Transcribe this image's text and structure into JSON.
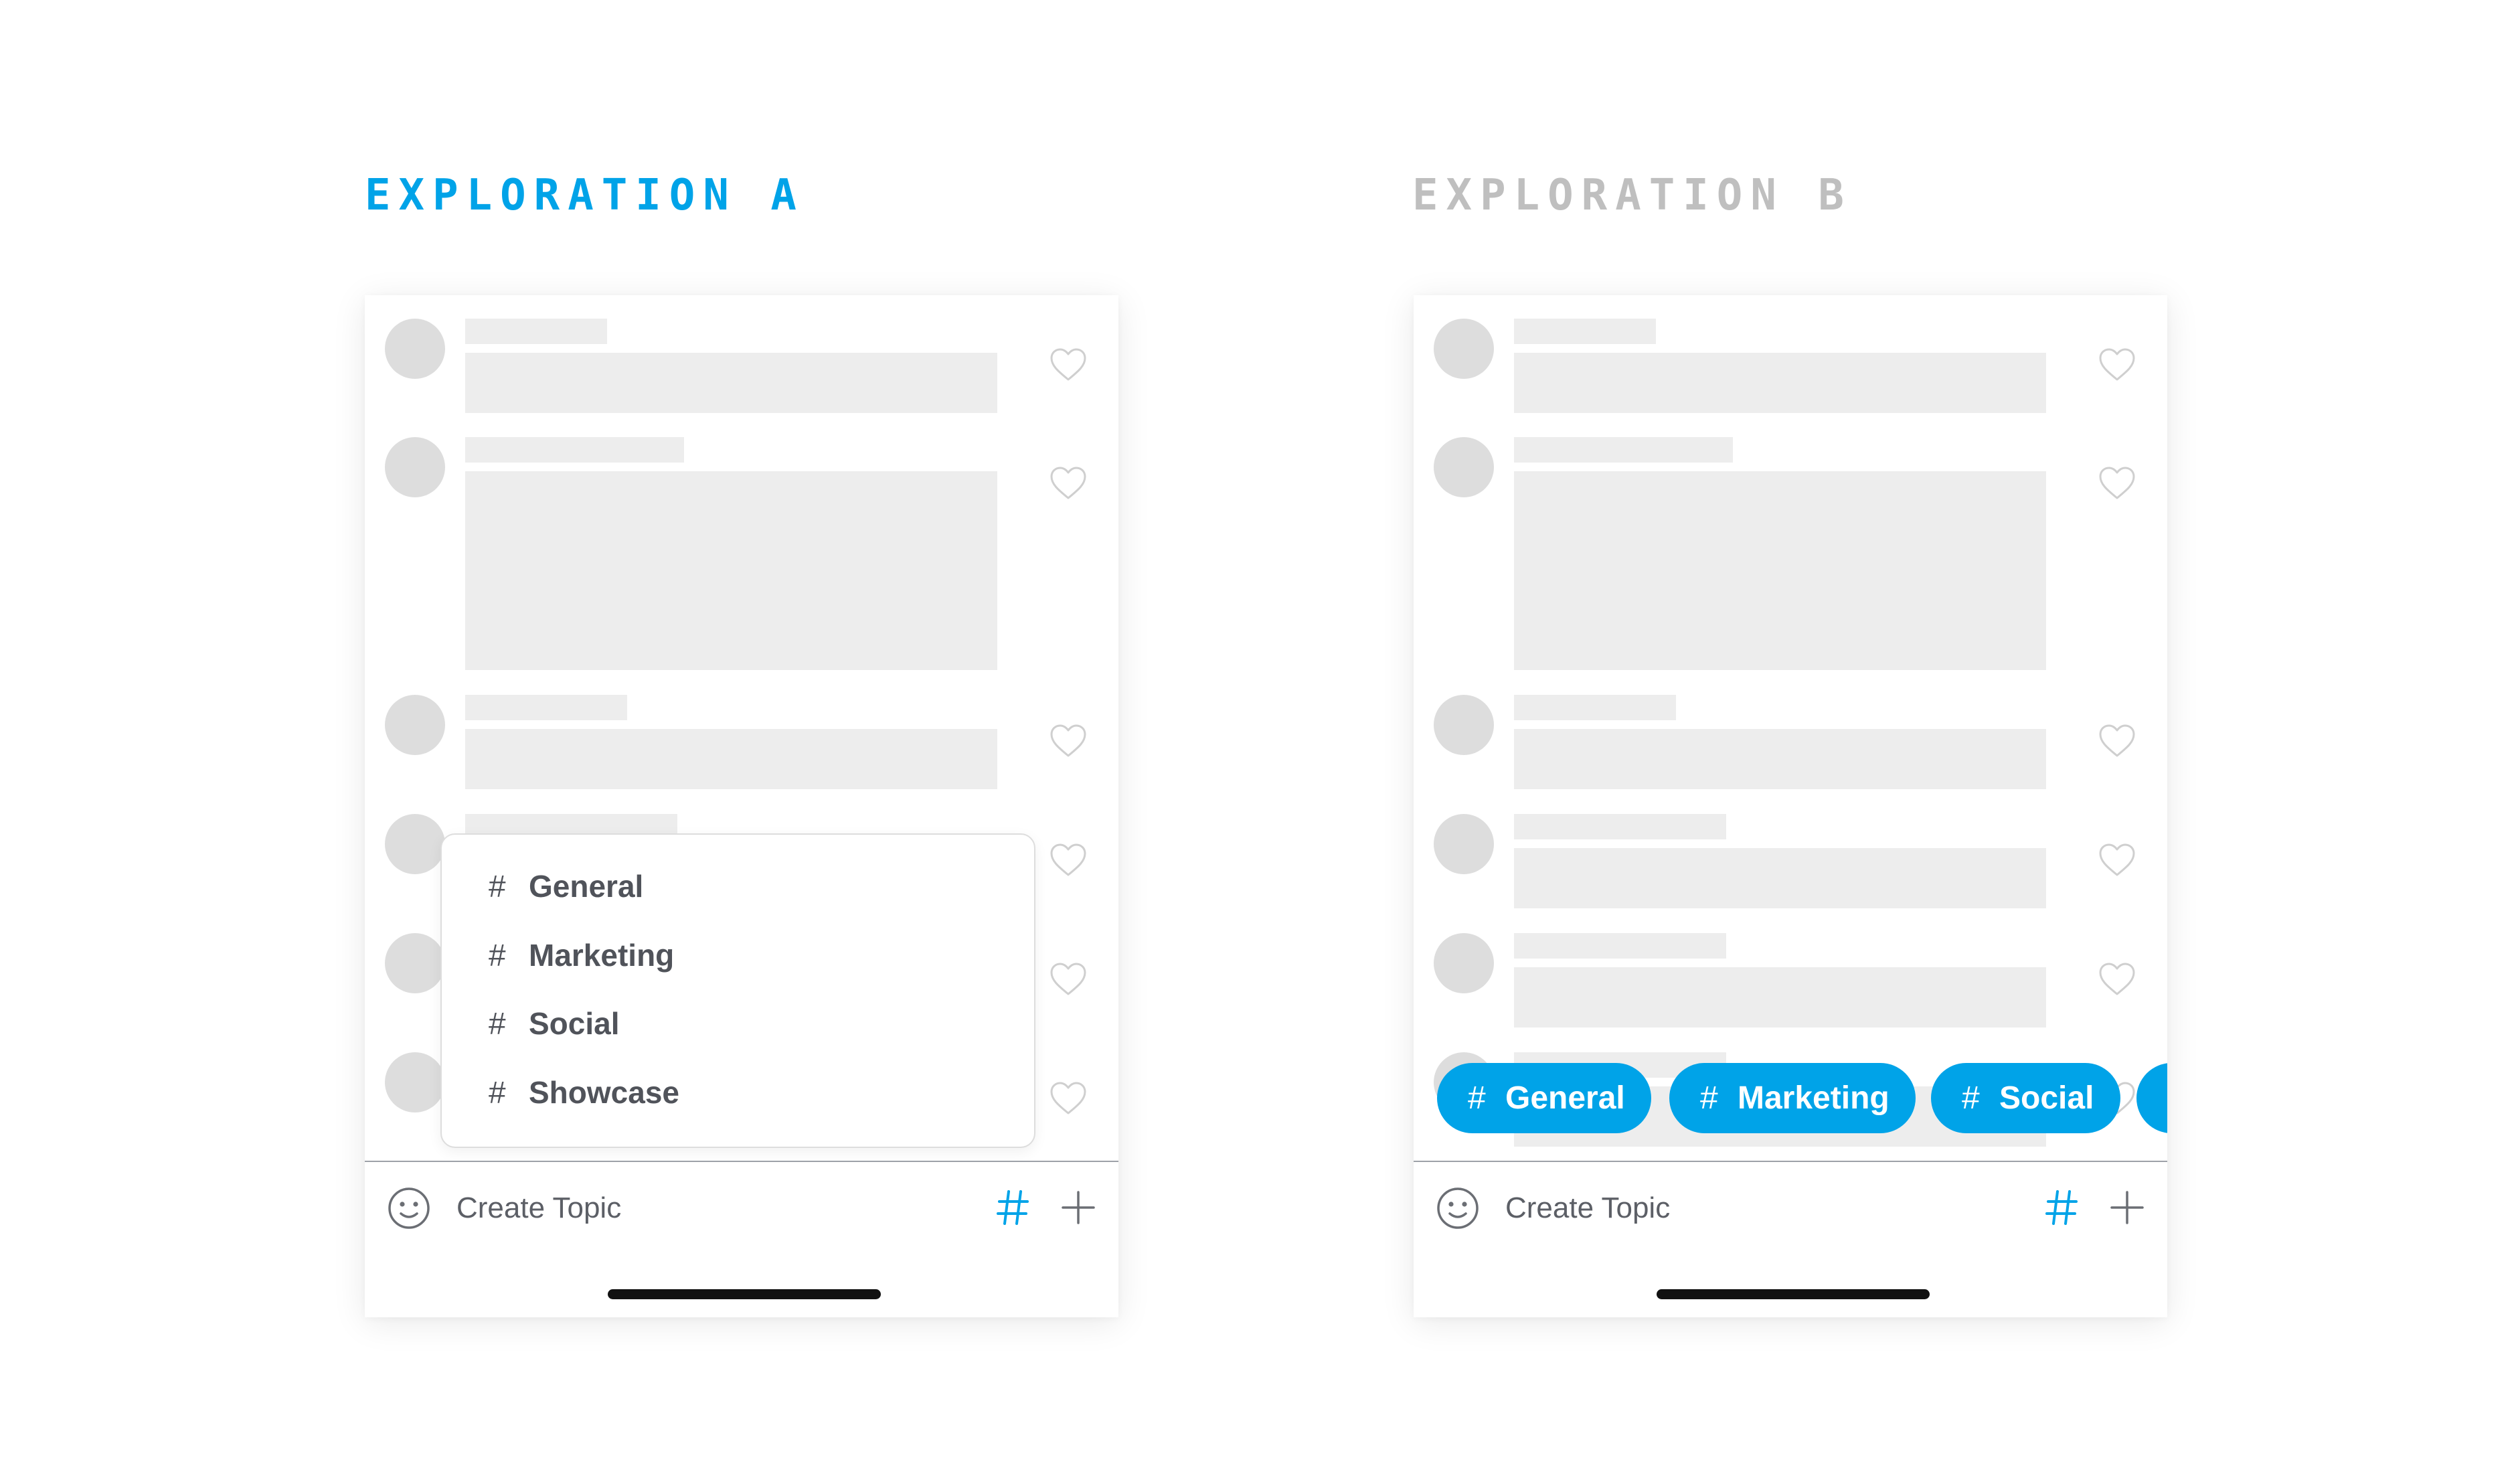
{
  "explorations": {
    "a": {
      "title": "EXPLORATION A",
      "accent": "#00A3E8",
      "composer_label": "Create Topic"
    },
    "b": {
      "title": "EXPLORATION B",
      "accent": "#BFBFBF",
      "composer_label": "Create Topic"
    }
  },
  "topic_dropdown": {
    "items": [
      {
        "hash": "#",
        "label": "General"
      },
      {
        "hash": "#",
        "label": "Marketing"
      },
      {
        "hash": "#",
        "label": "Social"
      },
      {
        "hash": "#",
        "label": "Showcase"
      }
    ]
  },
  "topic_chips": {
    "items": [
      {
        "hash": "#",
        "label": "General"
      },
      {
        "hash": "#",
        "label": "Marketing"
      },
      {
        "hash": "#",
        "label": "Social"
      }
    ]
  },
  "icons": {
    "post_action": "heart-icon",
    "composer_emoji": "smiley-icon",
    "composer_topic": "hashtag-icon",
    "composer_add": "plus-icon"
  },
  "colors": {
    "brand_blue": "#00A3E8",
    "placeholder_fill": "#EDEDED",
    "avatar_fill": "#DDDDDD",
    "text_gray": "#50535A"
  }
}
